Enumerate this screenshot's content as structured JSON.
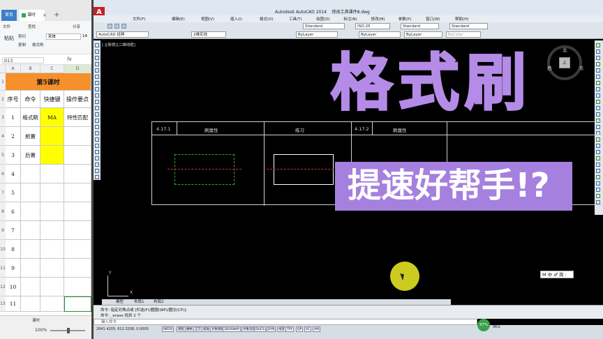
{
  "spreadsheet": {
    "tabs": {
      "home": "首页",
      "file": "课时",
      "close": "×",
      "add": "+"
    },
    "ribbon": {
      "file_menu": "文件",
      "cut": "剪切",
      "copy": "复制",
      "paste": "粘贴",
      "format_painter": "格式刷",
      "search": "查找",
      "share": "分享"
    },
    "font_name": "宋体",
    "font_size": "14",
    "cell_ref": "D13",
    "fx": "fx",
    "columns": [
      "A",
      "B",
      "C",
      "D"
    ],
    "title": "第5课时",
    "header": [
      "序号",
      "命令",
      "快捷键",
      "操作要点"
    ],
    "rows": [
      {
        "num": "1",
        "cmd": "格式刷",
        "key": "MA",
        "op": "特性匹配"
      },
      {
        "num": "2",
        "cmd": "前置",
        "key": "",
        "op": ""
      },
      {
        "num": "3",
        "cmd": "后置",
        "key": "",
        "op": ""
      },
      {
        "num": "4",
        "cmd": "",
        "key": "",
        "op": ""
      },
      {
        "num": "5",
        "cmd": "",
        "key": "",
        "op": ""
      },
      {
        "num": "6",
        "cmd": "",
        "key": "",
        "op": ""
      },
      {
        "num": "7",
        "cmd": "",
        "key": "",
        "op": ""
      },
      {
        "num": "8",
        "cmd": "",
        "key": "",
        "op": ""
      },
      {
        "num": "9",
        "cmd": "",
        "key": "",
        "op": ""
      },
      {
        "num": "10",
        "cmd": "",
        "key": "",
        "op": ""
      },
      {
        "num": "11",
        "cmd": "",
        "key": "",
        "op": ""
      }
    ],
    "row_heads": [
      "1",
      "2",
      "3",
      "4",
      "5",
      "6",
      "7",
      "8",
      "9",
      "10",
      "11",
      "12",
      "13"
    ],
    "sheet_tab": "课时",
    "zoom": "100%"
  },
  "autocad": {
    "app_title": "Autodesk AutoCAD 2014",
    "file_name": "修改工具课件8.dwg",
    "menus": [
      "文件(F)",
      "编辑(E)",
      "视图(V)",
      "插入(I)",
      "格式(O)",
      "工具(T)",
      "绘图(D)",
      "标注(N)",
      "修改(M)",
      "参数(P)",
      "窗口(W)",
      "帮助(H)"
    ],
    "workspace": "AutoCAD 经典",
    "view_preset": "2维实线",
    "text_style": "Standard",
    "dim_style": "ISO-25",
    "table_style": "Standard",
    "multileader_style": "Standard",
    "layer": "ByLayer",
    "linetype": "ByLayer",
    "lineweight": "ByLayer",
    "color": "ByColor",
    "viewport_label": "[-][俯视][二维线框]",
    "compass": {
      "north": "北",
      "west": "西",
      "east": "东",
      "cube": "上"
    },
    "drawing": {
      "cell1": "4.17.1",
      "cell2": "刷属性",
      "cell3": "练习",
      "cell4": "4.17.2",
      "cell5": "刷属性"
    },
    "ime": "M 中 ♂ 简 :",
    "layout_tabs": [
      "模型",
      "布局1",
      "布局2"
    ],
    "cmd_history1": "命令: 指定对角点或 [栏选(F)/圈围(WP)/圈交(CP)]:",
    "cmd_history2": "命令: _erase 找到 2 个",
    "cmd_prompt": "键入命令",
    "coords": "2841.4205, 612.3208, 0.0000",
    "status_buttons": [
      "INFER",
      "捕捉",
      "栅格",
      "正交",
      "极轴",
      "对象捕捉",
      "3DOSNAP",
      "对象追踪",
      "DUCS",
      "DYN",
      "线宽",
      "TPY",
      "QP",
      "SC",
      "AM"
    ],
    "net_percent": "37%",
    "net_up": "0K/s",
    "net_down": "0K/s"
  },
  "overlay": {
    "title": "格式刷",
    "subtitle": "提速好帮手!?"
  },
  "colors": {
    "overlay_purple": "#b48be6",
    "title_orange": "#f6902a",
    "yellow": "#ffff00"
  }
}
